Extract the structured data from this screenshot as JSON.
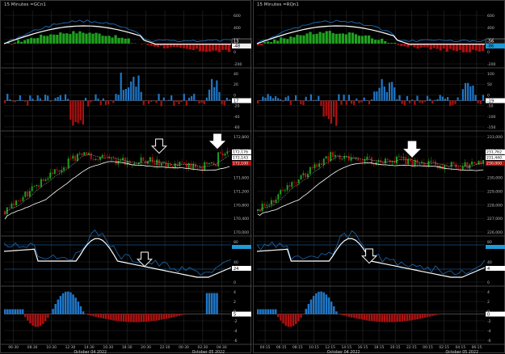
{
  "windows": [
    {
      "title": "15 Minutes =GCn1",
      "panes": [
        {
          "id": "macd",
          "ticks": [
            "600",
            "400",
            "200",
            "0",
            "-200"
          ],
          "last_value_top": "13",
          "last_value_bottom": "-48"
        },
        {
          "id": "volume_diff",
          "ticks": [
            "40",
            "20",
            "0",
            "-20",
            "-40",
            "-60"
          ],
          "last_value": "17"
        },
        {
          "id": "price",
          "ticks": [
            "172,800",
            "172,400",
            "172,000",
            "171,600",
            "171,200",
            "170,800",
            "170,400",
            "170,000"
          ],
          "last_labels": [
            "172,176",
            "172,143",
            "172,100"
          ]
        },
        {
          "id": "stochastic",
          "ticks": [
            "80",
            "40",
            "0"
          ],
          "last_value": "24"
        },
        {
          "id": "histogram",
          "ticks": [
            "4",
            "2",
            "0",
            "-2",
            "-4",
            "-6"
          ],
          "last_value": "5"
        }
      ],
      "time_ticks": [
        "06:30",
        "08:30",
        "10:30",
        "12:30",
        "14:30",
        "16:30",
        "18:30",
        "20:30",
        "22:30",
        "00:30",
        "02:30",
        "04:30"
      ],
      "date_labels": [
        "October 04 2022",
        "October 05 2022"
      ]
    },
    {
      "title": "15 Minutes =RQn1",
      "panes": [
        {
          "id": "macd",
          "ticks": [
            "600",
            "400",
            "200",
            "0",
            "-200"
          ],
          "last_value_top": "-56",
          "last_value_bottom": "-86"
        },
        {
          "id": "volume_diff",
          "ticks": [
            "100",
            "50",
            "0",
            "-50",
            "-100",
            "-150"
          ],
          "last_value": "-19"
        },
        {
          "id": "price",
          "ticks": [
            "233,000",
            "232,000",
            "231,000",
            "230,000",
            "229,000",
            "228,000",
            "227,000",
            "226,000"
          ],
          "last_labels": [
            "231,762",
            "231,440",
            "230,000"
          ]
        },
        {
          "id": "stochastic",
          "ticks": [
            "80",
            "40",
            "0"
          ],
          "last_value": "4"
        },
        {
          "id": "histogram",
          "ticks": [
            "4",
            "2",
            "0",
            "-2",
            "-4",
            "-6"
          ],
          "last_value": "0"
        }
      ],
      "time_ticks": [
        "04:15",
        "06:15",
        "08:15",
        "10:15",
        "12:15",
        "14:15",
        "16:15",
        "18:15",
        "20:15",
        "22:15",
        "00:15",
        "02:15",
        "04:15",
        "06:15"
      ],
      "date_labels": [
        "October 04 2022",
        "October 05 2022"
      ]
    }
  ],
  "colors": {
    "background": "#000000",
    "grid": "#2a2a2a",
    "bull": "#1fa11f",
    "bear": "#b01010",
    "blue": "#1f77c9",
    "white": "#ffffff",
    "cyan_box": "#1f9ad6"
  },
  "annotations": [
    "down-arrow-outline",
    "down-arrow-filled"
  ]
}
